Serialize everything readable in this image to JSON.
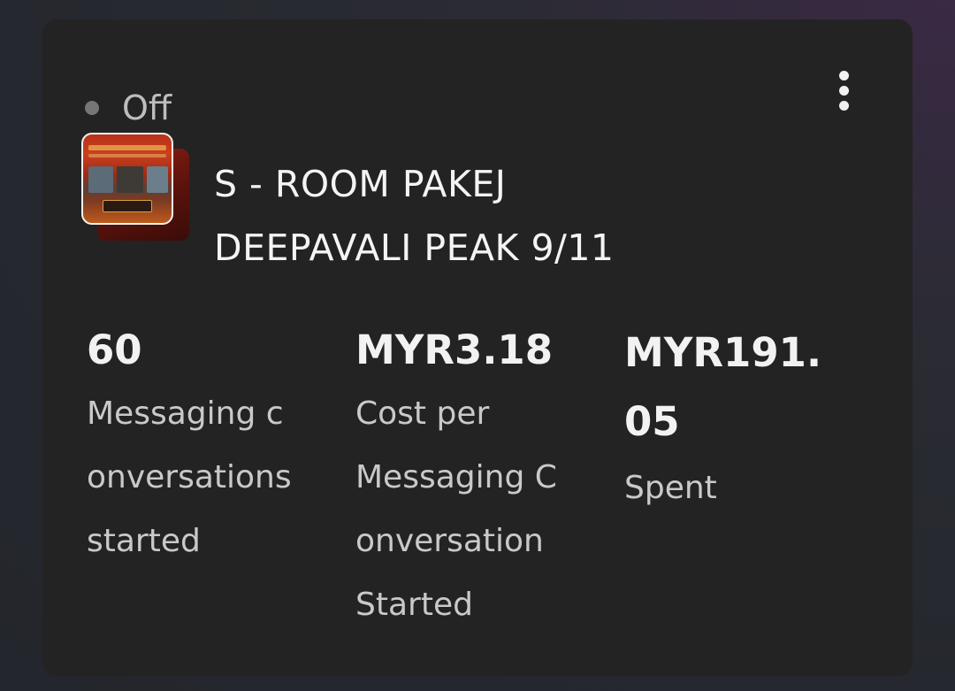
{
  "campaign": {
    "status": "Off",
    "title_line1": "S - ROOM PAKEJ",
    "title_line2": "DEEPAVALI PEAK 9/11",
    "menu_icon": "more-vertical-icon"
  },
  "metrics": [
    {
      "value_lines": [
        "60"
      ],
      "label_lines": [
        "Messaging c",
        "onversations",
        "started"
      ]
    },
    {
      "value_lines": [
        "MYR3.18"
      ],
      "label_lines": [
        "Cost per",
        "Messaging C",
        "onversation",
        "Started"
      ]
    },
    {
      "value_lines": [
        "MYR191.",
        "05"
      ],
      "label_lines": [
        "Spent"
      ]
    }
  ],
  "colors": {
    "card_background": "#232323",
    "status_dot": "#767676",
    "text_primary": "#f4f4f4",
    "text_secondary": "#c9c9c9"
  }
}
